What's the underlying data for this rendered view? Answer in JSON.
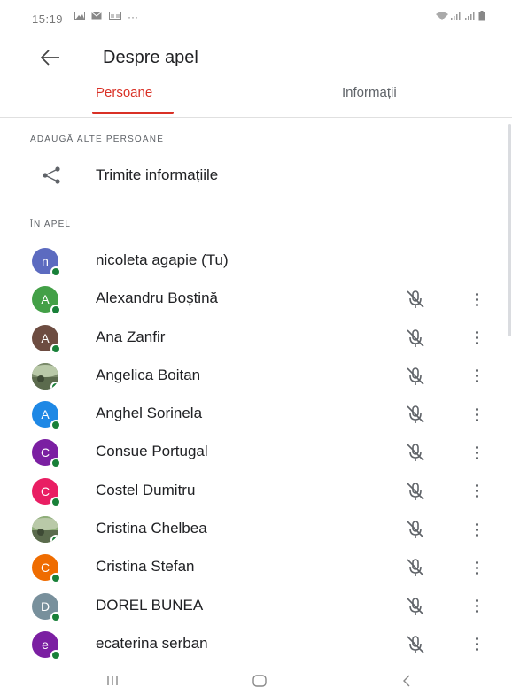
{
  "status_bar": {
    "time": "15:19",
    "notifications": [
      "gallery-icon",
      "message-icon",
      "voicemail-icon"
    ],
    "more": "···"
  },
  "header": {
    "title": "Despre apel"
  },
  "tabs": [
    {
      "label": "Persoane",
      "active": true
    },
    {
      "label": "Informații",
      "active": false
    }
  ],
  "add_section": {
    "label": "ADAUGĂ ALTE PERSOANE",
    "share_label": "Trimite informațiile"
  },
  "in_call_section": {
    "label": "ÎN APEL"
  },
  "participants": [
    {
      "name": "nicoleta agapie (Tu)",
      "initial": "n",
      "color": "#5c6bc0",
      "photo": false,
      "self": true
    },
    {
      "name": "Alexandru Boștină",
      "initial": "A",
      "color": "#43a047",
      "photo": false,
      "self": false
    },
    {
      "name": "Ana Zanfir",
      "initial": "A",
      "color": "#6d4c41",
      "photo": false,
      "self": false
    },
    {
      "name": "Angelica Boitan",
      "initial": "",
      "color": "#7a8a6a",
      "photo": true,
      "self": false
    },
    {
      "name": "Anghel Sorinela",
      "initial": "A",
      "color": "#1e88e5",
      "photo": false,
      "self": false
    },
    {
      "name": "Consue Portugal",
      "initial": "C",
      "color": "#7b1fa2",
      "photo": false,
      "self": false
    },
    {
      "name": "Costel Dumitru",
      "initial": "C",
      "color": "#e91e63",
      "photo": false,
      "self": false
    },
    {
      "name": "Cristina Chelbea",
      "initial": "",
      "color": "#8fae7a",
      "photo": true,
      "self": false
    },
    {
      "name": "Cristina Stefan",
      "initial": "C",
      "color": "#ef6c00",
      "photo": false,
      "self": false
    },
    {
      "name": "DOREL BUNEA",
      "initial": "D",
      "color": "#78909c",
      "photo": false,
      "self": false
    },
    {
      "name": "ecaterina serban",
      "initial": "e",
      "color": "#7b1fa2",
      "photo": false,
      "self": false
    }
  ],
  "colors": {
    "accent": "#d93025",
    "presence": "#188038"
  }
}
